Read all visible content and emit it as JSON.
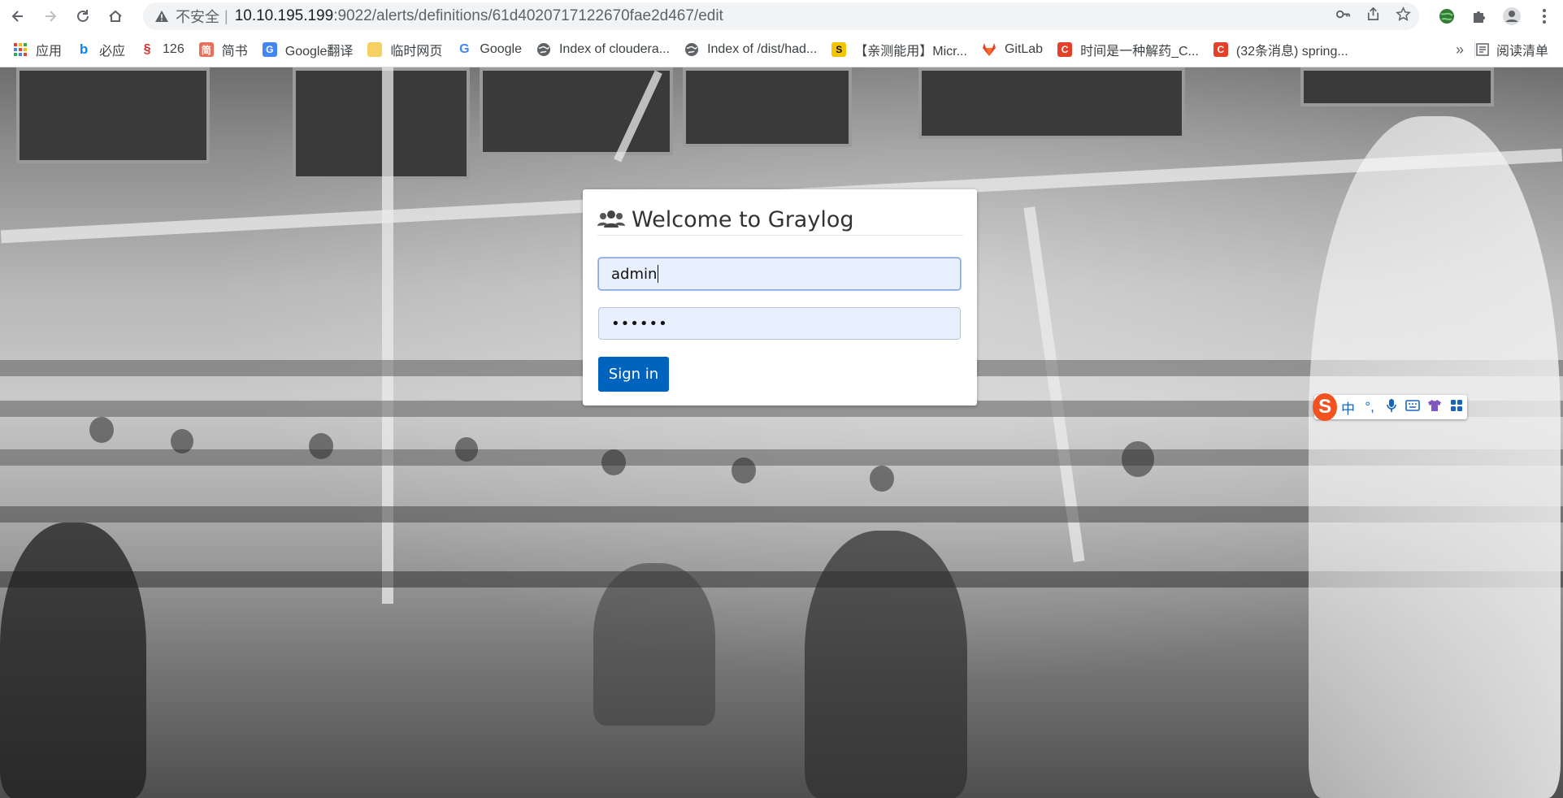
{
  "browser": {
    "security_label": "不安全",
    "url_host": "10.10.195.199",
    "url_path": ":9022/alerts/definitions/61d4020717122670fae2d467/edit",
    "bookmarks": [
      {
        "label": "应用",
        "icon": "apps-grid-icon",
        "color": "#e94235"
      },
      {
        "label": "必应",
        "icon": "bing-icon",
        "color": "#0a84ff"
      },
      {
        "label": "126",
        "icon": "126-mail-icon",
        "color": "#d62b2b"
      },
      {
        "label": "简书",
        "icon": "jianshu-icon",
        "color": "#ea6f5a"
      },
      {
        "label": "Google翻译",
        "icon": "google-translate-icon",
        "color": "#4285f4"
      },
      {
        "label": "临时网页",
        "icon": "folder-icon",
        "color": "#f5d063"
      },
      {
        "label": "Google",
        "icon": "google-icon",
        "color": "#4285f4"
      },
      {
        "label": "Index of cloudera...",
        "icon": "globe-icon",
        "color": "#5f6368"
      },
      {
        "label": "Index of /dist/had...",
        "icon": "globe-icon",
        "color": "#5f6368"
      },
      {
        "label": "【亲测能用】Micr...",
        "icon": "sticker-icon",
        "color": "#f5c400"
      },
      {
        "label": "GitLab",
        "icon": "gitlab-icon",
        "color": "#e24329"
      },
      {
        "label": "时间是一种解药_C...",
        "icon": "csdn-icon",
        "color": "#e4402a"
      },
      {
        "label": "(32条消息) spring...",
        "icon": "csdn-icon",
        "color": "#e4402a"
      }
    ],
    "more_label": "»",
    "reading_list_label": "阅读清单"
  },
  "login": {
    "title": "Welcome to Graylog",
    "username_value": "admin",
    "password_value": "••••••",
    "signin_label": "Sign in",
    "button_color": "#0063be"
  },
  "ime": {
    "logo_label": "S",
    "mode_label": "中",
    "punct_label": "°,"
  }
}
